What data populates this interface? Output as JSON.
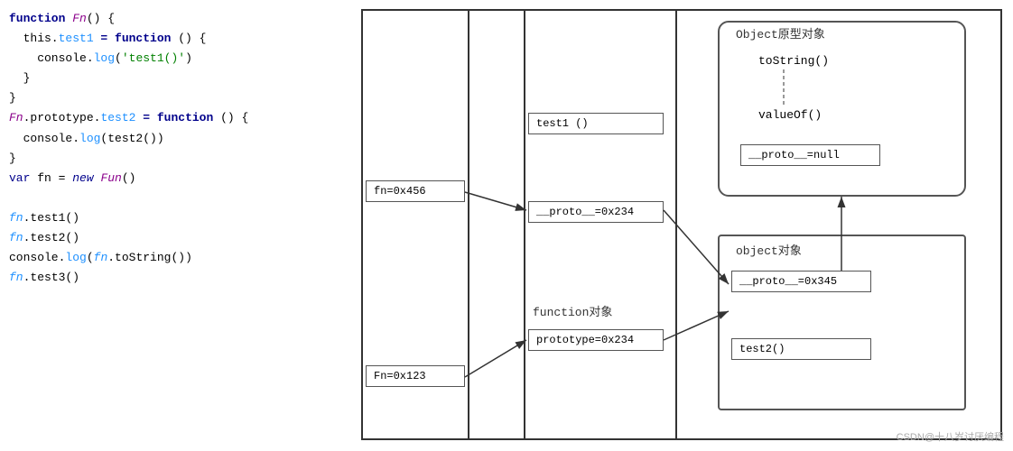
{
  "code": {
    "lines": [
      {
        "id": "l1",
        "parts": [
          {
            "text": "function ",
            "cls": "kw"
          },
          {
            "text": "Fn",
            "cls": "fn-name"
          },
          {
            "text": "() {",
            "cls": ""
          }
        ]
      },
      {
        "id": "l2",
        "parts": [
          {
            "text": "  this.",
            "cls": ""
          },
          {
            "text": "test1",
            "cls": "prop"
          },
          {
            "text": " = ",
            "cls": "kw"
          },
          {
            "text": "function",
            "cls": "kw"
          },
          {
            "text": " () {",
            "cls": ""
          }
        ]
      },
      {
        "id": "l3",
        "parts": [
          {
            "text": "    console.",
            "cls": ""
          },
          {
            "text": "log",
            "cls": "prop"
          },
          {
            "text": "(",
            "cls": ""
          },
          {
            "text": "'test1()'",
            "cls": "str"
          },
          {
            "text": ")",
            "cls": ""
          }
        ]
      },
      {
        "id": "l4",
        "parts": [
          {
            "text": "  }",
            "cls": ""
          }
        ]
      },
      {
        "id": "l5",
        "parts": [
          {
            "text": "}",
            "cls": ""
          }
        ]
      },
      {
        "id": "l6",
        "parts": [
          {
            "text": "Fn",
            "cls": "fn-name"
          },
          {
            "text": ".prototype.",
            "cls": ""
          },
          {
            "text": "test2",
            "cls": "prop"
          },
          {
            "text": " = ",
            "cls": "kw"
          },
          {
            "text": "function",
            "cls": "kw"
          },
          {
            "text": " () {",
            "cls": ""
          }
        ]
      },
      {
        "id": "l7",
        "parts": [
          {
            "text": "  console.",
            "cls": ""
          },
          {
            "text": "log",
            "cls": "prop"
          },
          {
            "text": "(test2())",
            "cls": ""
          }
        ]
      },
      {
        "id": "l8",
        "parts": [
          {
            "text": "}",
            "cls": ""
          }
        ]
      },
      {
        "id": "l9",
        "parts": [
          {
            "text": "var",
            "cls": "var-kw"
          },
          {
            "text": " fn = ",
            "cls": ""
          },
          {
            "text": "new",
            "cls": "new-kw"
          },
          {
            "text": " ",
            "cls": ""
          },
          {
            "text": "Fun",
            "cls": "fn-name"
          },
          {
            "text": "()",
            "cls": ""
          }
        ]
      },
      {
        "id": "l10",
        "parts": []
      },
      {
        "id": "l11",
        "parts": [
          {
            "text": "fn",
            "cls": "italic-blue"
          },
          {
            "text": ".test1()",
            "cls": ""
          }
        ]
      },
      {
        "id": "l12",
        "parts": [
          {
            "text": "fn",
            "cls": "italic-blue"
          },
          {
            "text": ".test2()",
            "cls": ""
          }
        ]
      },
      {
        "id": "l13",
        "parts": [
          {
            "text": "console.",
            "cls": ""
          },
          {
            "text": "log",
            "cls": "prop"
          },
          {
            "text": "(",
            "cls": ""
          },
          {
            "text": "fn",
            "cls": "italic-blue"
          },
          {
            "text": ".toString())",
            "cls": ""
          }
        ]
      },
      {
        "id": "l14",
        "parts": [
          {
            "text": "fn",
            "cls": "italic-blue"
          },
          {
            "text": ".test3()",
            "cls": ""
          }
        ]
      }
    ]
  },
  "diagram": {
    "outer_box_label": "",
    "fn456": "fn=0x456",
    "fn123": "Fn=0x123",
    "test1": "test1 ()",
    "proto234": "__proto__=0x234",
    "function_label": "function对象",
    "prototype234": "prototype=0x234",
    "object_proto_title": "Object原型对象",
    "tostring": "toString()",
    "valueof": "valueOf()",
    "proto_null": "__proto__=null",
    "object_obj_title": "object对象",
    "proto345": "__proto__=0x345",
    "test2": "test2()"
  },
  "watermark": "CSDN@十八岁讨厌编程"
}
